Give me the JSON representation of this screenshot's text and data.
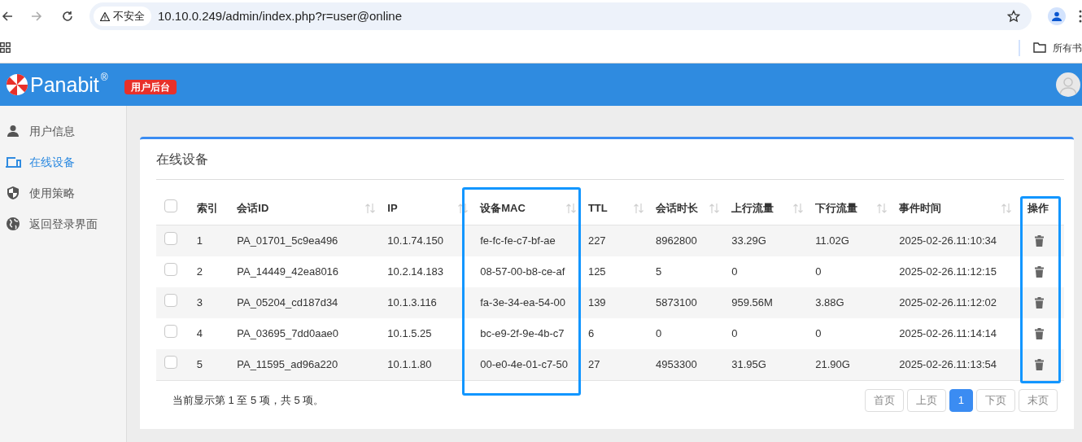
{
  "browser": {
    "security_label": "不安全",
    "url": "10.10.0.249/admin/index.php?r=user@online",
    "bookmarks_folder": "所有书"
  },
  "header": {
    "brand": "Panabit",
    "brand_mark": "®",
    "badge": "用户后台"
  },
  "sidebar": {
    "items": [
      {
        "label": "用户信息",
        "kind": "user",
        "selected": false
      },
      {
        "label": "在线设备",
        "kind": "devices",
        "selected": true
      },
      {
        "label": "使用策略",
        "kind": "shield",
        "selected": false
      },
      {
        "label": "返回登录界面",
        "kind": "globe",
        "selected": false
      }
    ]
  },
  "panel": {
    "title": "在线设备",
    "table": {
      "select_all": {
        "checked": false
      },
      "columns": [
        {
          "label": "索引",
          "sortable": false
        },
        {
          "label": "会话ID",
          "sortable": true
        },
        {
          "label": "IP",
          "sortable": true
        },
        {
          "label": "设备MAC",
          "sortable": true
        },
        {
          "label": "TTL",
          "sortable": true
        },
        {
          "label": "会话时长",
          "sortable": true
        },
        {
          "label": "上行流量",
          "sortable": true
        },
        {
          "label": "下行流量",
          "sortable": true
        },
        {
          "label": "事件时间",
          "sortable": true
        },
        {
          "label": "操作",
          "sortable": false
        }
      ],
      "rows": [
        {
          "checked": false,
          "cells": [
            "1",
            "PA_01701_5c9ea496",
            "10.1.74.150",
            "fe-fc-fe-c7-bf-ae",
            "227",
            "8962800",
            "33.29G",
            "11.02G",
            "2025-02-26.11:10:34"
          ]
        },
        {
          "checked": false,
          "cells": [
            "2",
            "PA_14449_42ea8016",
            "10.2.14.183",
            "08-57-00-b8-ce-af",
            "125",
            "5",
            "0",
            "0",
            "2025-02-26.11:12:15"
          ]
        },
        {
          "checked": false,
          "cells": [
            "3",
            "PA_05204_cd187d34",
            "10.1.3.116",
            "fa-3e-34-ea-54-00",
            "139",
            "5873100",
            "959.56M",
            "3.88G",
            "2025-02-26.11:12:02"
          ]
        },
        {
          "checked": false,
          "cells": [
            "4",
            "PA_03695_7dd0aae0",
            "10.1.5.25",
            "bc-e9-2f-9e-4b-c7",
            "6",
            "0",
            "0",
            "0",
            "2025-02-26.11:14:14"
          ]
        },
        {
          "checked": false,
          "cells": [
            "5",
            "PA_11595_ad96a220",
            "10.1.1.80",
            "00-e0-4e-01-c7-50",
            "27",
            "4953300",
            "31.95G",
            "21.90G",
            "2025-02-26.11:13:54"
          ]
        }
      ]
    },
    "summary": "当前显示第 1 至 5 项，共 5 项。",
    "pagination": [
      {
        "label": "首页",
        "selected": false
      },
      {
        "label": "上页",
        "selected": false
      },
      {
        "label": "1",
        "selected": true
      },
      {
        "label": "下页",
        "selected": false
      },
      {
        "label": "末页",
        "selected": false
      }
    ]
  }
}
